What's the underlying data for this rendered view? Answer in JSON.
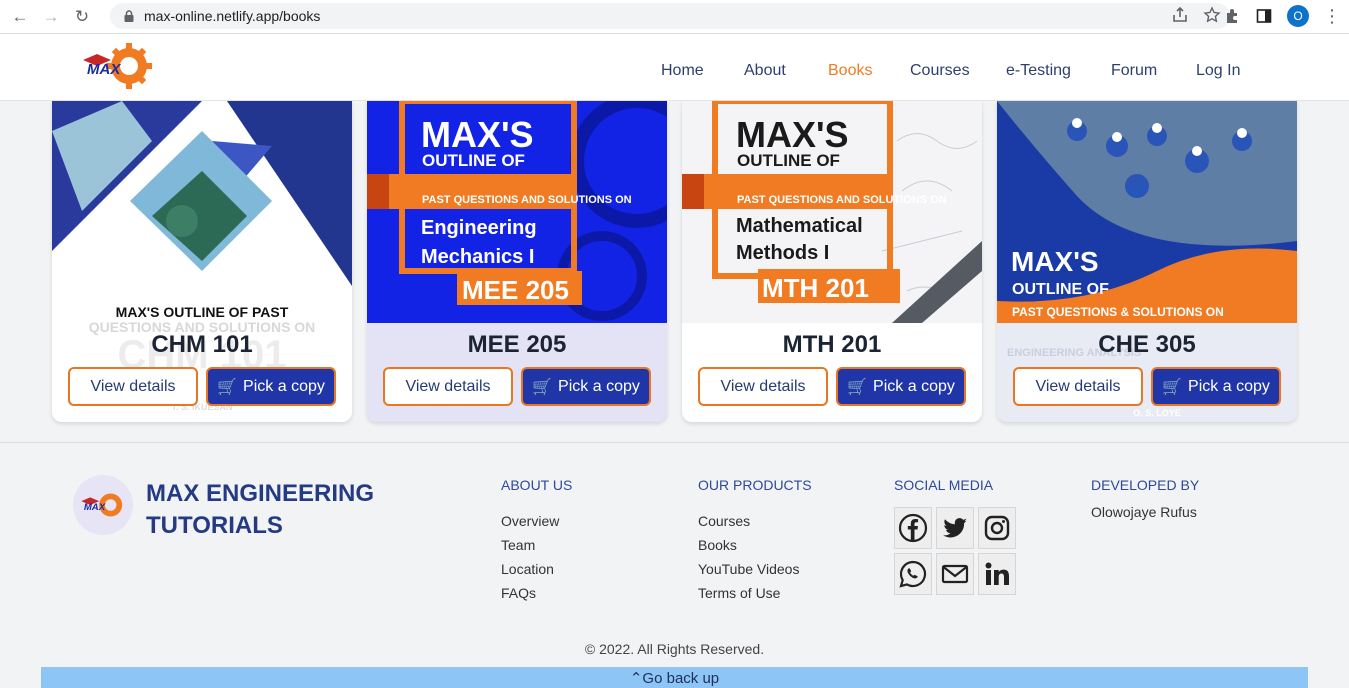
{
  "browser": {
    "url": "max-online.netlify.app/books",
    "profile_initial": "O"
  },
  "header": {
    "logo_text": "MAX",
    "nav": [
      {
        "label": "Home",
        "active": false
      },
      {
        "label": "About",
        "active": false
      },
      {
        "label": "Books",
        "active": true
      },
      {
        "label": "Courses",
        "active": false
      },
      {
        "label": "e-Testing",
        "active": false
      },
      {
        "label": "Forum",
        "active": false
      },
      {
        "label": "Log In",
        "active": false
      }
    ]
  },
  "books": [
    {
      "code": "CHM 101",
      "cover_title": "MAX'S OUTLINE OF PAST",
      "cover_sub": "QUESTIONS AND SOLUTIONS ON",
      "cover_big": "CHM 101",
      "cover_author": "T. S. IKUESAN",
      "view_label": "View details",
      "pick_label": "Pick a copy"
    },
    {
      "code": "MEE 205",
      "cover_title": "MAX'S",
      "cover_sub": "OUTLINE OF",
      "cover_band": "PAST QUESTIONS AND SOLUTIONS ON",
      "cover_subject_1": "Engineering",
      "cover_subject_2": "Mechanics I",
      "cover_big": "MEE 205",
      "view_label": "View details",
      "pick_label": "Pick a copy"
    },
    {
      "code": "MTH 201",
      "cover_title": "MAX'S",
      "cover_sub": "OUTLINE OF",
      "cover_band": "PAST QUESTIONS AND SOLUTIONS ON",
      "cover_subject_1": "Mathematical",
      "cover_subject_2": "Methods I",
      "cover_big": "MTH 201",
      "view_label": "View details",
      "pick_label": "Pick a copy"
    },
    {
      "code": "CHE 305",
      "cover_title": "MAX'S",
      "cover_sub": "OUTLINE OF",
      "cover_band": "PAST QUESTIONS & SOLUTIONS ON",
      "cover_subject_1": "ENGINEERING ANALYSIS",
      "cover_author": "O. S. LOYE",
      "view_label": "View details",
      "pick_label": "Pick a copy"
    }
  ],
  "footer": {
    "brand_line1": "MAX ENGINEERING",
    "brand_line2": "TUTORIALS",
    "about": {
      "heading": "ABOUT US",
      "links": [
        "Overview",
        "Team",
        "Location",
        "FAQs"
      ]
    },
    "products": {
      "heading": "OUR PRODUCTS",
      "links": [
        "Courses",
        "Books",
        "YouTube Videos",
        "Terms of Use"
      ]
    },
    "social": {
      "heading": "SOCIAL MEDIA",
      "icons": [
        "facebook-icon",
        "twitter-icon",
        "instagram-icon",
        "whatsapp-icon",
        "mail-icon",
        "linkedin-icon"
      ]
    },
    "developer": {
      "heading": "DEVELOPED BY",
      "name": "Olowojaye Rufus"
    },
    "copyright": "© 2022. All Rights Reserved.",
    "back_up": "Go back up"
  },
  "colors": {
    "accent_orange": "#f07b22",
    "brand_blue": "#2036a8",
    "nav_text": "#2d3f6e"
  }
}
